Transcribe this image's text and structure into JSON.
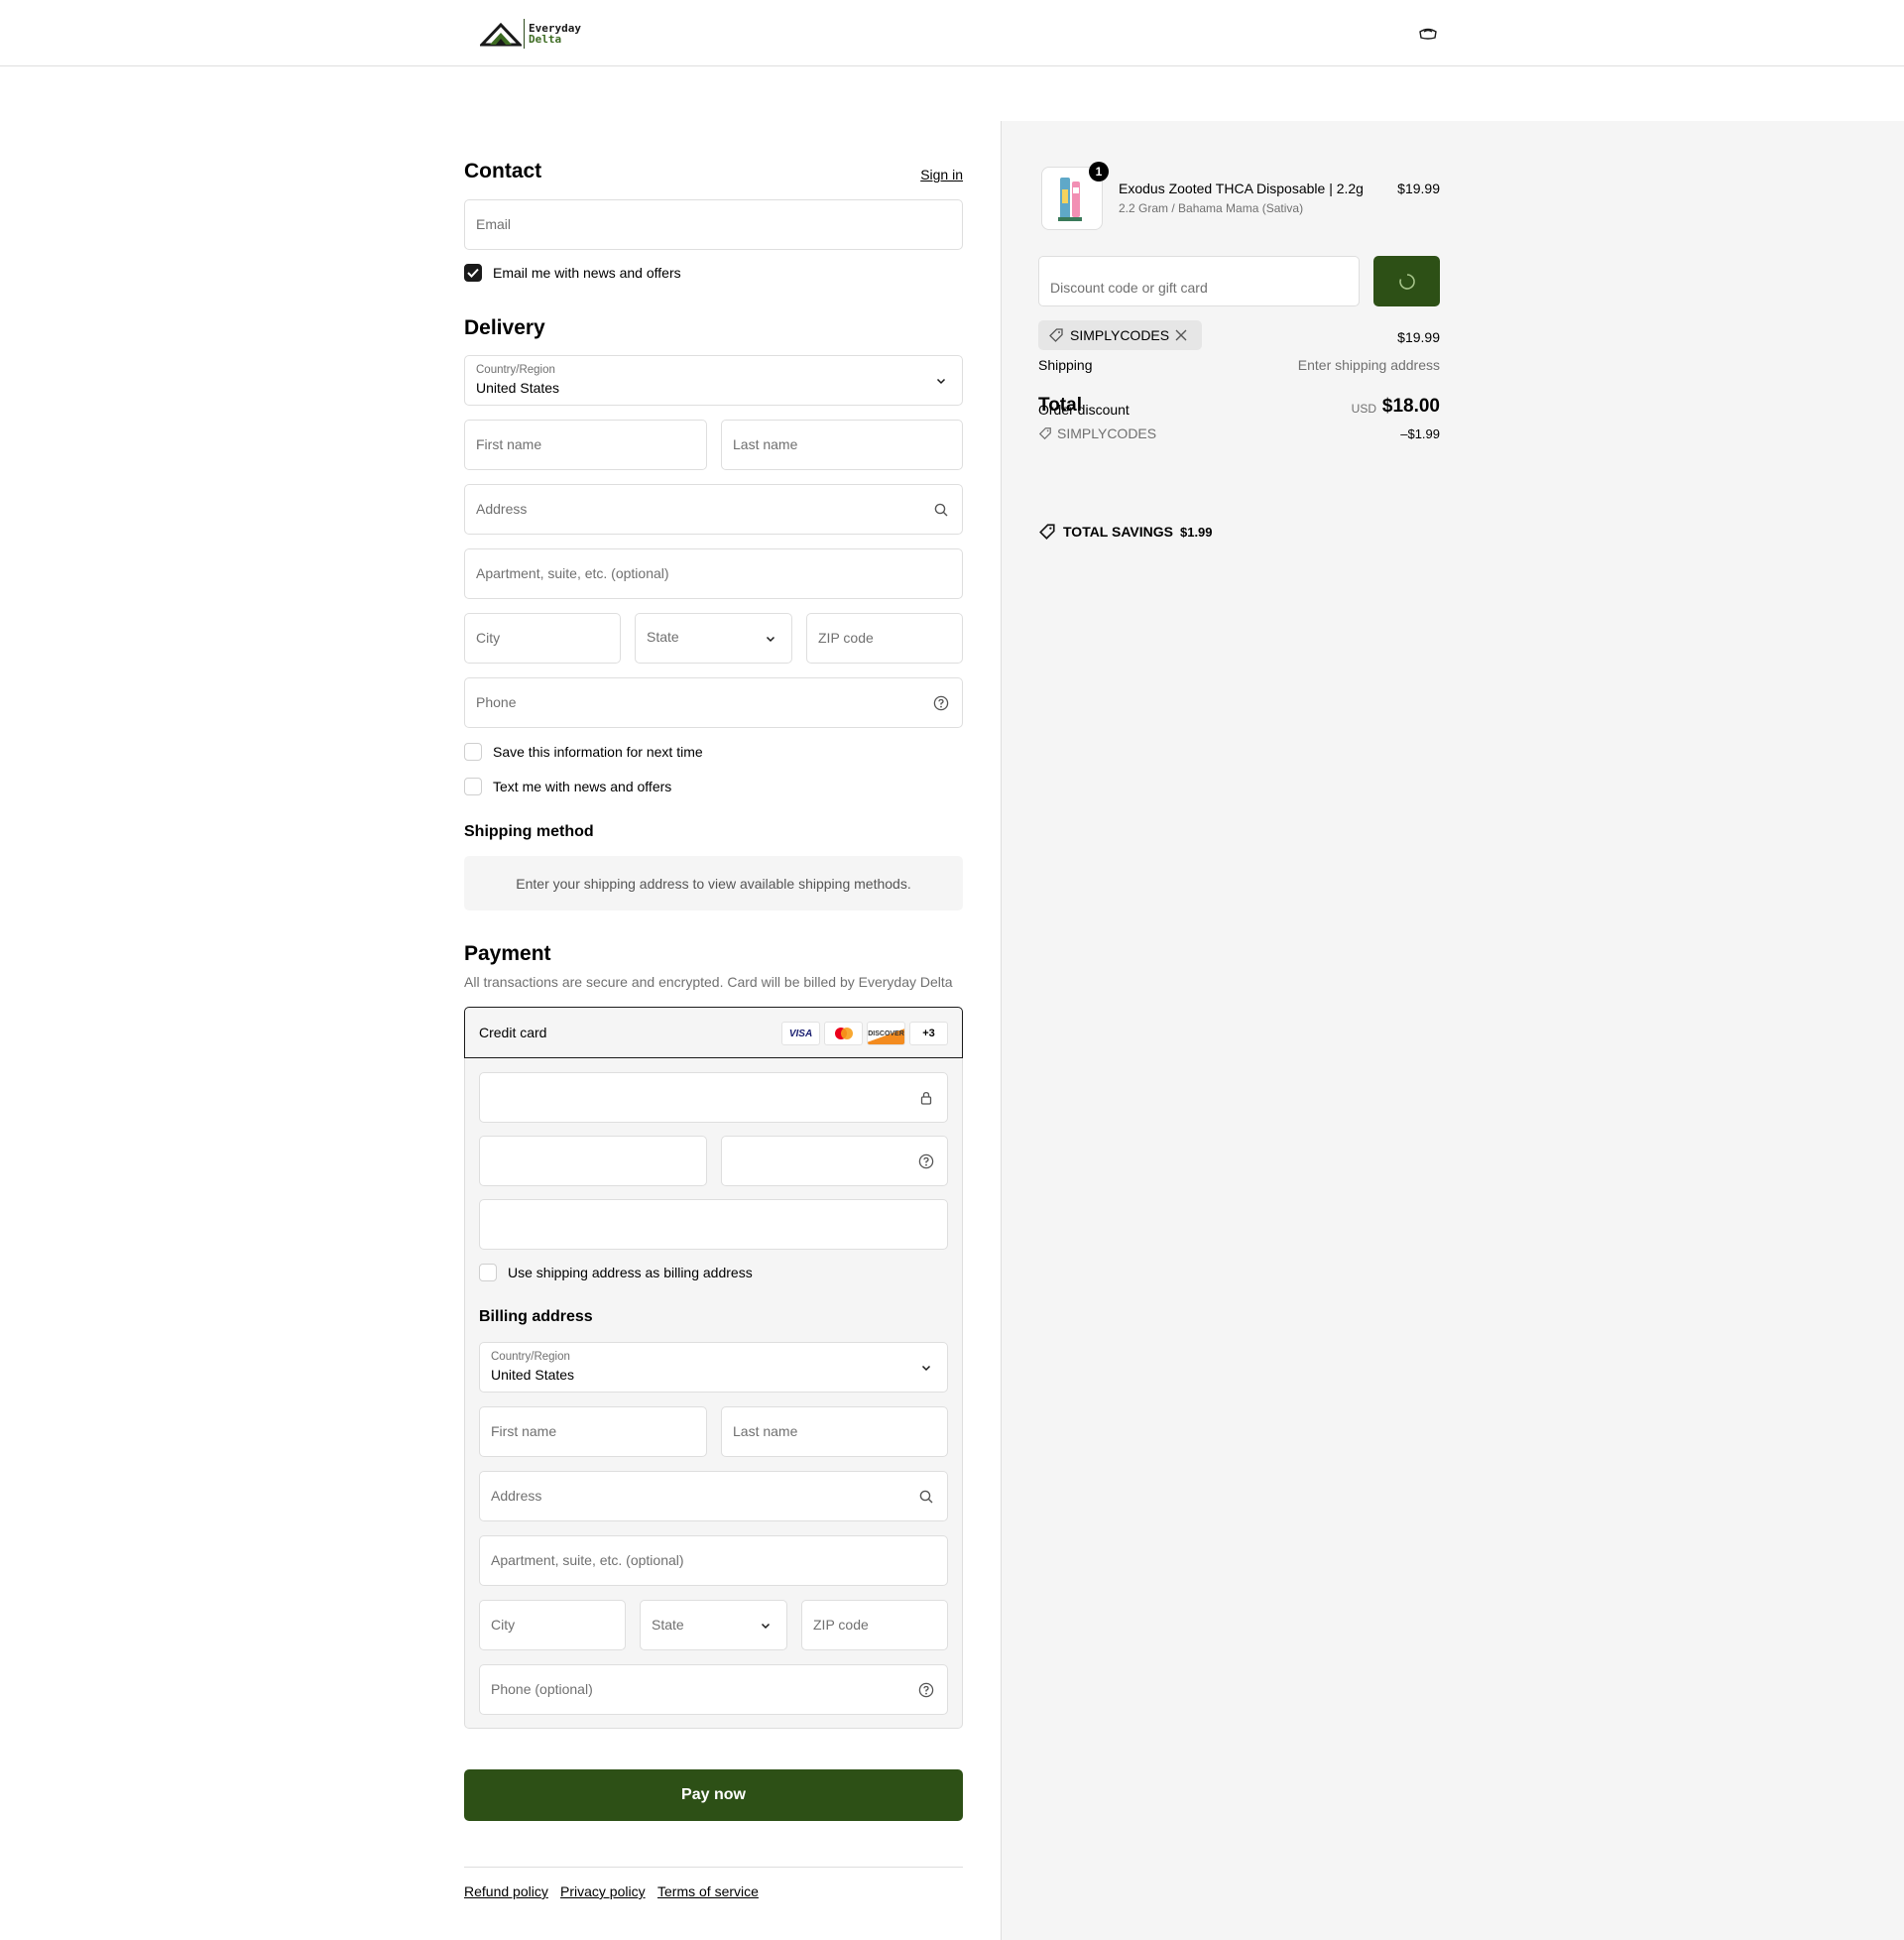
{
  "header": {
    "logo_line1": "Everyday",
    "logo_line2": "Delta"
  },
  "contact": {
    "title": "Contact",
    "sign_in": "Sign in",
    "email_placeholder": "Email",
    "news_label": "Email me with news and offers"
  },
  "delivery": {
    "title": "Delivery",
    "country_label": "Country/Region",
    "country_value": "United States",
    "first_name": "First name",
    "last_name": "Last name",
    "address": "Address",
    "apartment": "Apartment, suite, etc. (optional)",
    "city": "City",
    "state": "State",
    "zip": "ZIP code",
    "phone": "Phone",
    "save_info": "Save this information for next time",
    "text_me": "Text me with news and offers"
  },
  "shipping_method": {
    "title": "Shipping method",
    "message": "Enter your shipping address to view available shipping methods."
  },
  "payment": {
    "title": "Payment",
    "subtitle": "All transactions are secure and encrypted. Card will be billed by Everyday Delta",
    "credit_card": "Credit card",
    "card_brands": [
      "VISA",
      "DISCOVER",
      "+3"
    ],
    "use_shipping": "Use shipping address as billing address",
    "billing_title": "Billing address",
    "billing_country_label": "Country/Region",
    "billing_country_value": "United States",
    "billing_first_name": "First name",
    "billing_last_name": "Last name",
    "billing_address": "Address",
    "billing_apartment": "Apartment, suite, etc. (optional)",
    "billing_city": "City",
    "billing_state": "State",
    "billing_zip": "ZIP code",
    "billing_phone": "Phone (optional)",
    "pay_now": "Pay now"
  },
  "footer": {
    "refund": "Refund policy",
    "privacy": "Privacy policy",
    "terms": "Terms of service"
  },
  "summary": {
    "item_name": "Exodus Zooted THCA Disposable | 2.2g",
    "item_variant": "2.2 Gram / Bahama Mama (Sativa)",
    "item_price": "$19.99",
    "item_qty": "1",
    "discount_placeholder": "Discount code or gift card",
    "applied_code": "SIMPLYCODES",
    "subtotal_value": "$19.99",
    "shipping_label": "Shipping",
    "shipping_value": "Enter shipping address",
    "total_label": "Total",
    "order_discount_label": "Order discount",
    "currency": "USD",
    "total_value": "$18.00",
    "discount_code": "SIMPLYCODES",
    "discount_value": "–$1.99",
    "savings_label": "TOTAL SAVINGS",
    "savings_value": "$1.99"
  },
  "colors": {
    "brand_green": "#2d5016",
    "panel_bg": "#f5f5f5",
    "border": "#dedede"
  }
}
